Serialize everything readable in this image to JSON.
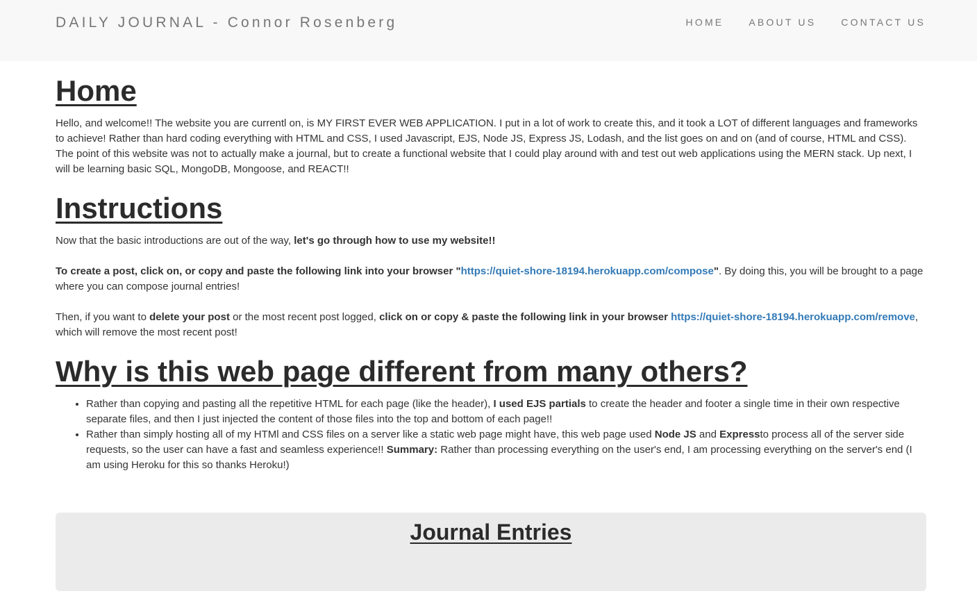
{
  "navbar": {
    "brand": "DAILY JOURNAL - Connor Rosenberg",
    "links": [
      "HOME",
      "ABOUT US",
      "CONTACT US"
    ]
  },
  "home": {
    "heading": "Home",
    "paragraph": "Hello, and welcome!! The website you are currentl on, is MY FIRST EVER WEB APPLICATION. I put in a lot of work to create this, and it took a LOT of different languages and frameworks to achieve! Rather than hard coding everything with HTML and CSS, I used Javascript, EJS, Node JS, Express JS, Lodash, and the list goes on and on (and of course, HTML and CSS). The point of this website was not to actually make a journal, but to create a functional website that I could play around with and test out web applications using the MERN stack. Up next, I will be learning basic SQL, MongoDB, Mongoose, and REACT!!"
  },
  "instructions": {
    "heading": "Instructions",
    "intro_plain": "Now that the basic introductions are out of the way, ",
    "intro_bold": "let's go through how to use my website!!",
    "create_bold": "To create a post, click on, or copy and paste the following link into your browser \"",
    "create_link": "https://quiet-shore-18194.herokuapp.com/compose",
    "create_bold_end": "\"",
    "create_rest": ". By doing this, you will be brought to a page where you can compose journal entries!",
    "delete_plain1": "Then, if you want to ",
    "delete_bold1": "delete your post",
    "delete_plain2": " or the most recent post logged, ",
    "delete_bold2": "click on or copy & paste the following link in your browser",
    "delete_space": " ",
    "delete_link": "https://quiet-shore-18194.herokuapp.com/remove",
    "delete_rest": ", which will remove the most recent post!"
  },
  "why": {
    "heading": "Why is this web page different from many others?",
    "bullet1_plain1": "Rather than copying and pasting all the repetitive HTML for each page (like the header), ",
    "bullet1_bold": "I used EJS partials",
    "bullet1_plain2": " to create the header and footer a single time in their own respective separate files, and then I just injected the content of those files into the top and bottom of each page!!",
    "bullet2_plain1": "Rather than simply hosting all of my HTMl and CSS files on a server like a static web page might have, this web page used ",
    "bullet2_bold1": "Node JS",
    "bullet2_plain2": " and ",
    "bullet2_bold2": "Express",
    "bullet2_plain3": "to process all of the server side requests, so the user can have a fast and seamless experience!! ",
    "bullet2_bold3": "Summary:",
    "bullet2_plain4": " Rather than processing everything on the user's end, I am processing everything on the server's end (I am using Heroku for this so thanks Heroku!)"
  },
  "entries": {
    "heading": "Journal Entries"
  }
}
